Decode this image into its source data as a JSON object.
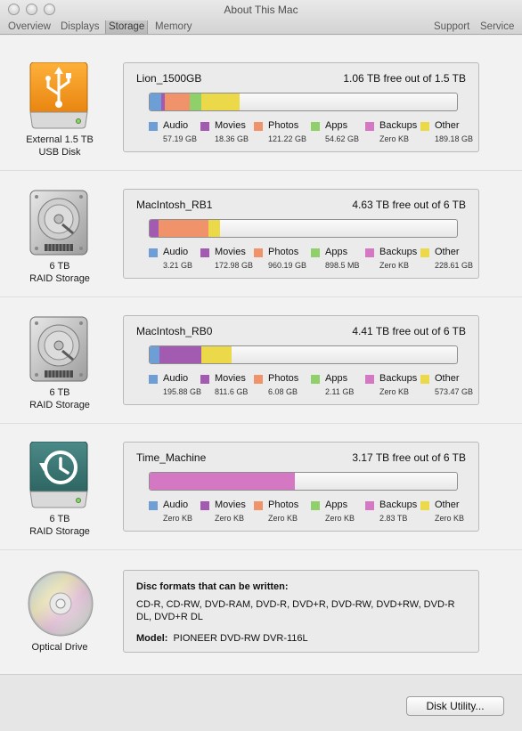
{
  "window": {
    "title": "About This Mac",
    "tabs": [
      "Overview",
      "Displays",
      "Storage",
      "Memory"
    ],
    "right_tabs": [
      "Support",
      "Service"
    ],
    "active_tab": "Storage"
  },
  "legend_categories": [
    {
      "name": "Audio",
      "color": "#6d9fd6"
    },
    {
      "name": "Movies",
      "color": "#a25bb0"
    },
    {
      "name": "Photos",
      "color": "#f0926a"
    },
    {
      "name": "Apps",
      "color": "#8fd06a"
    },
    {
      "name": "Backups",
      "color": "#d478c4"
    },
    {
      "name": "Other",
      "color": "#ebd94a"
    }
  ],
  "devices": [
    {
      "label_line1": "External 1.5 TB",
      "label_line2": "USB Disk",
      "icon": "usb-drive-icon",
      "volume": "Lion_1500GB",
      "free_text": "1.06 TB free out of 1.5 TB",
      "usage_fractions": [
        0.038,
        0.012,
        0.081,
        0.036,
        0.0,
        0.126
      ],
      "sizes": [
        "57.19 GB",
        "18.36 GB",
        "121.22 GB",
        "54.62 GB",
        "Zero KB",
        "189.18 GB"
      ]
    },
    {
      "label_line1": "6 TB",
      "label_line2": "RAID Storage",
      "icon": "hard-drive-icon",
      "volume": "MacIntosh_RB1",
      "free_text": "4.63 TB free out of 6 TB",
      "usage_fractions": [
        0.001,
        0.029,
        0.16,
        0.0001,
        0.0,
        0.038
      ],
      "sizes": [
        "3.21 GB",
        "172.98 GB",
        "960.19 GB",
        "898.5 MB",
        "Zero KB",
        "228.61 GB"
      ]
    },
    {
      "label_line1": "6 TB",
      "label_line2": "RAID Storage",
      "icon": "hard-drive-icon",
      "volume": "MacIntosh_RB0",
      "free_text": "4.41 TB free out of 6 TB",
      "usage_fractions": [
        0.033,
        0.135,
        0.001,
        0.0004,
        0.0,
        0.096
      ],
      "sizes": [
        "195.88 GB",
        "811.6 GB",
        "6.08 GB",
        "2.11 GB",
        "Zero KB",
        "573.47 GB"
      ]
    },
    {
      "label_line1": "6 TB",
      "label_line2": "RAID Storage",
      "icon": "time-machine-drive-icon",
      "volume": "Time_Machine",
      "free_text": "3.17 TB free out of 6 TB",
      "usage_fractions": [
        0.0,
        0.0,
        0.0,
        0.0,
        0.472,
        0.0
      ],
      "sizes": [
        "Zero KB",
        "Zero KB",
        "Zero KB",
        "Zero KB",
        "2.83 TB",
        "Zero KB"
      ]
    }
  ],
  "optical": {
    "label": "Optical Drive",
    "icon": "optical-disc-icon",
    "heading": "Disc formats that can be written:",
    "formats": "CD-R, CD-RW, DVD-RAM, DVD-R, DVD+R, DVD-RW, DVD+RW, DVD-R DL, DVD+R DL",
    "model_label": "Model:",
    "model": "PIONEER DVD-RW DVR-116L"
  },
  "disk_utility_button": "Disk Utility..."
}
